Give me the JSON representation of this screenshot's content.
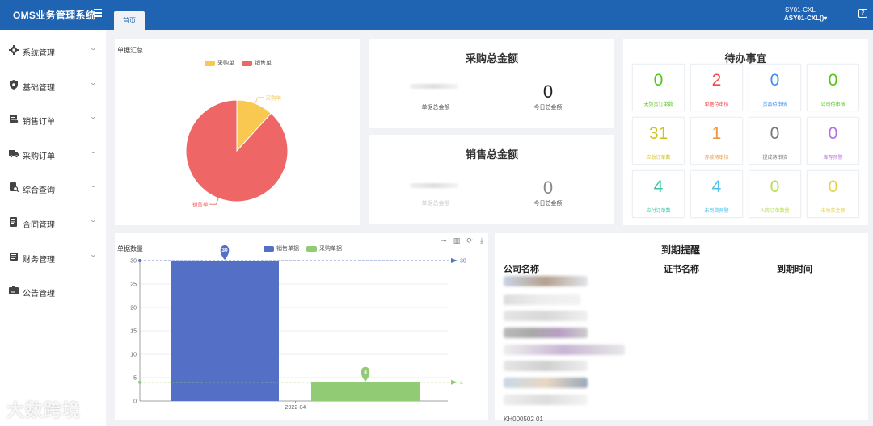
{
  "app": {
    "title": "OMS业务管理系统"
  },
  "tabs": [
    {
      "label": "首页"
    }
  ],
  "user": {
    "code": "SY01-CXL",
    "name": "ASY01-CXL()▾"
  },
  "sidebar": {
    "items": [
      {
        "label": "系统管理",
        "icon": "gear-icon"
      },
      {
        "label": "基础管理",
        "icon": "shield-icon"
      },
      {
        "label": "销售订单",
        "icon": "clipboard-icon"
      },
      {
        "label": "采购订单",
        "icon": "truck-icon"
      },
      {
        "label": "综合查询",
        "icon": "search-doc-icon"
      },
      {
        "label": "合同管理",
        "icon": "contract-icon"
      },
      {
        "label": "财务管理",
        "icon": "finance-icon"
      },
      {
        "label": "公告管理",
        "icon": "notice-icon"
      }
    ]
  },
  "pie_card": {
    "title": "单据汇总",
    "legend": [
      {
        "name": "采购单",
        "color": "#f9c851"
      },
      {
        "name": "销售单",
        "color": "#ee6666"
      }
    ],
    "slice_labels": {
      "purchase": "采购单",
      "sales": "销售单"
    }
  },
  "purchase_total": {
    "title": "采购总金额",
    "left_label": "单据总金额",
    "right_value": "0",
    "right_label": "今日总金额"
  },
  "sales_total": {
    "title": "销售总金额",
    "left_label": "单据总金额",
    "right_value": "0",
    "right_label": "今日总金额"
  },
  "todo": {
    "title": "待办事宜",
    "tiles": [
      {
        "value": "0",
        "label": "无负责订单数",
        "color": "#52c41a"
      },
      {
        "value": "2",
        "label": "单据待审核",
        "color": "#f5454f"
      },
      {
        "value": "0",
        "label": "货品待审核",
        "color": "#3f8ef2"
      },
      {
        "value": "0",
        "label": "公司待审核",
        "color": "#52c41a"
      },
      {
        "value": "31",
        "label": "应收订单数",
        "color": "#d4c21f"
      },
      {
        "value": "1",
        "label": "存款待审核",
        "color": "#f0973c"
      },
      {
        "value": "0",
        "label": "提成待审核",
        "color": "#777777"
      },
      {
        "value": "0",
        "label": "库存预警",
        "color": "#b36fe0"
      },
      {
        "value": "4",
        "label": "应付订单数",
        "color": "#3cc5a8"
      },
      {
        "value": "4",
        "label": "未到货预警",
        "color": "#4fc0e8"
      },
      {
        "value": "0",
        "label": "入库订单数量",
        "color": "#b4e04a"
      },
      {
        "value": "0",
        "label": "未收款金额",
        "color": "#e7d24f"
      }
    ]
  },
  "bar_card": {
    "title": "单据数量",
    "tools": [
      "line-chart-icon",
      "bar-chart-icon",
      "refresh-icon",
      "download-icon"
    ]
  },
  "chart_data": [
    {
      "type": "pie",
      "title": "单据汇总",
      "slices": [
        {
          "name": "采购单",
          "value": 4,
          "color": "#f9c851"
        },
        {
          "name": "销售单",
          "value": 30,
          "color": "#ee6666"
        }
      ],
      "legend_position": "top-center"
    },
    {
      "type": "bar",
      "title": "单据数量",
      "categories": [
        "2022-04"
      ],
      "series": [
        {
          "name": "销售单据",
          "values": [
            30
          ],
          "color": "#5470c6"
        },
        {
          "name": "采购单据",
          "values": [
            4
          ],
          "color": "#91cc75"
        }
      ],
      "ylim": [
        0,
        30
      ],
      "yticks": [
        "0",
        "5",
        "10",
        "15",
        "20",
        "25",
        "30"
      ],
      "markers": [
        "30",
        "4"
      ],
      "markline_labels": [
        "30",
        "4"
      ],
      "grid": true,
      "legend_position": "top-center"
    }
  ],
  "expire": {
    "title": "到期提醒",
    "columns": [
      "公司名称",
      "证书名称",
      "到期时间"
    ],
    "partial_row_text": "KH000502 01"
  },
  "watermark": "大数跨境"
}
